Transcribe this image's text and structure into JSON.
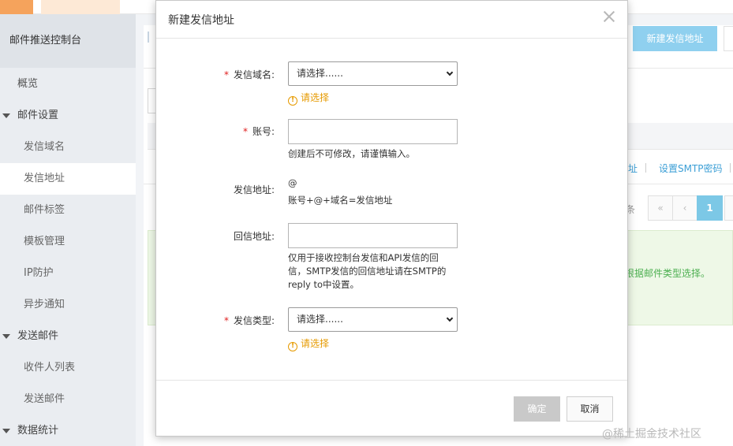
{
  "sidebar": {
    "header": "邮件推送控制台",
    "items": [
      {
        "label": "概览",
        "kind": "plain"
      },
      {
        "label": "邮件设置",
        "kind": "top"
      },
      {
        "label": "发信域名",
        "kind": "sub"
      },
      {
        "label": "发信地址",
        "kind": "sub",
        "active": true
      },
      {
        "label": "邮件标签",
        "kind": "sub"
      },
      {
        "label": "模板管理",
        "kind": "sub"
      },
      {
        "label": "IP防护",
        "kind": "sub"
      },
      {
        "label": "异步通知",
        "kind": "sub"
      },
      {
        "label": "发送邮件",
        "kind": "top"
      },
      {
        "label": "收件人列表",
        "kind": "sub"
      },
      {
        "label": "发送邮件",
        "kind": "sub"
      },
      {
        "label": "数据统计",
        "kind": "top"
      }
    ]
  },
  "main": {
    "new_address_button": "新建发信地址",
    "row_link_1": "址",
    "row_link_2": "设置SMTP密码",
    "pager_suffix": "条",
    "pager_first": "«",
    "pager_prev": "‹",
    "pager_current": "1",
    "tip_text": "根据邮件类型选择。"
  },
  "modal": {
    "title": "新建发信地址",
    "domain": {
      "label": "发信域名:",
      "required": "*",
      "selected": "请选择......",
      "warning": "请选择"
    },
    "account": {
      "label": "账号:",
      "required": "*",
      "value": "",
      "hint": "创建后不可修改，请谨慎输入。"
    },
    "sender": {
      "label": "发信地址:",
      "value": "@",
      "hint": "账号+@+域名=发信地址"
    },
    "reply": {
      "label": "回信地址:",
      "value": "",
      "hint_1": "仅用于接收控制台发信和API发信的回",
      "hint_2": "信，SMTP发信的回信地址请在SMTP的",
      "hint_3": "reply to中设置。"
    },
    "type": {
      "label": "发信类型:",
      "required": "*",
      "selected": "请选择......",
      "warning": "请选择"
    },
    "ok_button": "确定",
    "cancel_button": "取消"
  },
  "watermark": "@稀土掘金技术社区",
  "colors": {
    "accent_button": "#8fd0ef",
    "warning": "#e69a00",
    "required": "#e02020",
    "link": "#3c9fd6",
    "tip_green": "#4caf50"
  }
}
